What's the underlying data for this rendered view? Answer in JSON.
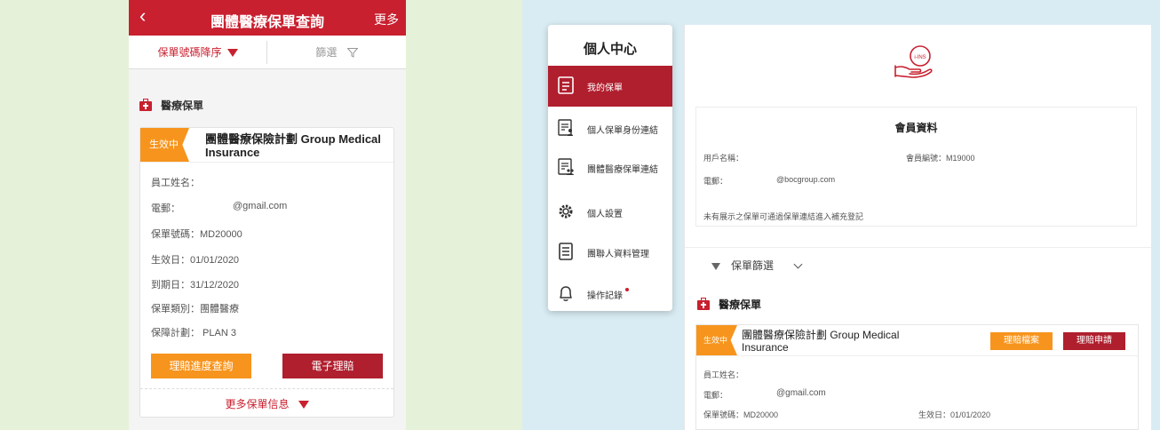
{
  "mobile": {
    "header": {
      "back": "‹",
      "title": "團體醫療保單查詢",
      "more": "更多"
    },
    "sort_label": "保單號碼降序",
    "filter_label": "篩選",
    "section_title": "醫療保單",
    "card": {
      "status": "生效中",
      "plan_name": "團體醫療保險計劃 Group Medical Insurance",
      "rows": [
        {
          "label": "員工姓名：",
          "value": ""
        },
        {
          "label": "電郵：",
          "value": "@gmail.com"
        },
        {
          "label": "保單號碼：MD20000",
          "value": ""
        },
        {
          "label": "生效日：01/01/2020",
          "value": ""
        },
        {
          "label": "到期日：31/12/2020",
          "value": ""
        },
        {
          "label": "保單類別：團體醫療",
          "value": ""
        },
        {
          "label": "保障計劃： PLAN 3",
          "value": ""
        }
      ],
      "btn_progress": "理賠進度查詢",
      "btn_eclaim": "電子理賠",
      "more_info": "更多保單信息"
    }
  },
  "desktop": {
    "sidebar": {
      "title": "個人中心",
      "items": [
        {
          "label": "我的保單",
          "active": true
        },
        {
          "label": "個人保單身份連結",
          "active": false
        },
        {
          "label": "團體醫療保單連結",
          "active": false
        },
        {
          "label": "個人設置",
          "active": false
        },
        {
          "label": "團聯人資料管理",
          "active": false
        },
        {
          "label": "操作記錄",
          "active": false
        }
      ]
    },
    "logo_text": "i-INS",
    "member": {
      "title": "會員資料",
      "username_label": "用戶名稱：",
      "member_no": "會員編號：M19000",
      "email_label": "電郵：",
      "email_value": "@bocgroup.com",
      "note": "未有展示之保單可通過保單連結進入補充登記"
    },
    "filter_label": "保單篩選",
    "section_title": "醫療保單",
    "card": {
      "status": "生效中",
      "plan_line1": "團體醫療保險計劃 Group Medical",
      "plan_line2": "Insurance",
      "btn_docs": "理賠檔案",
      "btn_apply": "理賠申請",
      "staff_label": "員工姓名：",
      "email_label": "電郵：",
      "email_value": "@gmail.com",
      "policy_no": "保單號碼：MD20000",
      "effective": "生效日：01/01/2020"
    }
  },
  "colors": {
    "brand_red": "#c8202f",
    "orange": "#f7941d",
    "dark_red": "#b01f2e"
  }
}
